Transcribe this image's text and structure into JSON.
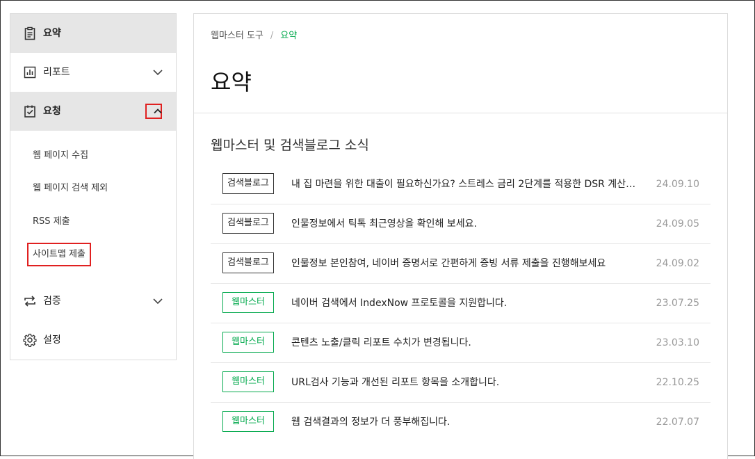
{
  "sidebar": {
    "items": [
      {
        "label": "요약",
        "icon": "clipboard-icon",
        "active": true
      },
      {
        "label": "리포트",
        "icon": "bar-chart-icon",
        "expandable": true
      },
      {
        "label": "요청",
        "icon": "clipboard-check-icon",
        "active": true,
        "expanded": true,
        "children": [
          "웹 페이지 수집",
          "웹 페이지 검색 제외",
          "RSS 제출",
          "사이트맵 제출"
        ]
      },
      {
        "label": "검증",
        "icon": "swap-icon",
        "expandable": true
      },
      {
        "label": "설정",
        "icon": "gear-icon"
      }
    ]
  },
  "breadcrumb": {
    "root": "웹마스터 도구",
    "separator": "/",
    "current": "요약"
  },
  "page_title": "요약",
  "section_title": "웹마스터 및 검색블로그 소식",
  "colors": {
    "accent": "#03a94d",
    "highlight": "#e02020",
    "active_bg": "#e6e6e6"
  },
  "news": [
    {
      "badge": "검색블로그",
      "type": "blog",
      "title": "내 집 마련을 위한 대출이 필요하신가요? 스트레스 금리 2단계를 적용한 DSR 계산…",
      "date": "24.09.10"
    },
    {
      "badge": "검색블로그",
      "type": "blog",
      "title": "인물정보에서 틱톡 최근영상을 확인해 보세요.",
      "date": "24.09.05"
    },
    {
      "badge": "검색블로그",
      "type": "blog",
      "title": "인물정보 본인참여, 네이버 증명서로 간편하게 증빙 서류 제출을 진행해보세요",
      "date": "24.09.02"
    },
    {
      "badge": "웹마스터",
      "type": "webmaster",
      "title": "네이버 검색에서 IndexNow 프로토콜을 지원합니다.",
      "date": "23.07.25"
    },
    {
      "badge": "웹마스터",
      "type": "webmaster",
      "title": "콘텐츠 노출/클릭 리포트 수치가 변경됩니다.",
      "date": "23.03.10"
    },
    {
      "badge": "웹마스터",
      "type": "webmaster",
      "title": "URL검사 기능과 개선된 리포트 항목을 소개합니다.",
      "date": "22.10.25"
    },
    {
      "badge": "웹마스터",
      "type": "webmaster",
      "title": "웹 검색결과의 정보가 더 풍부해집니다.",
      "date": "22.07.07"
    }
  ]
}
